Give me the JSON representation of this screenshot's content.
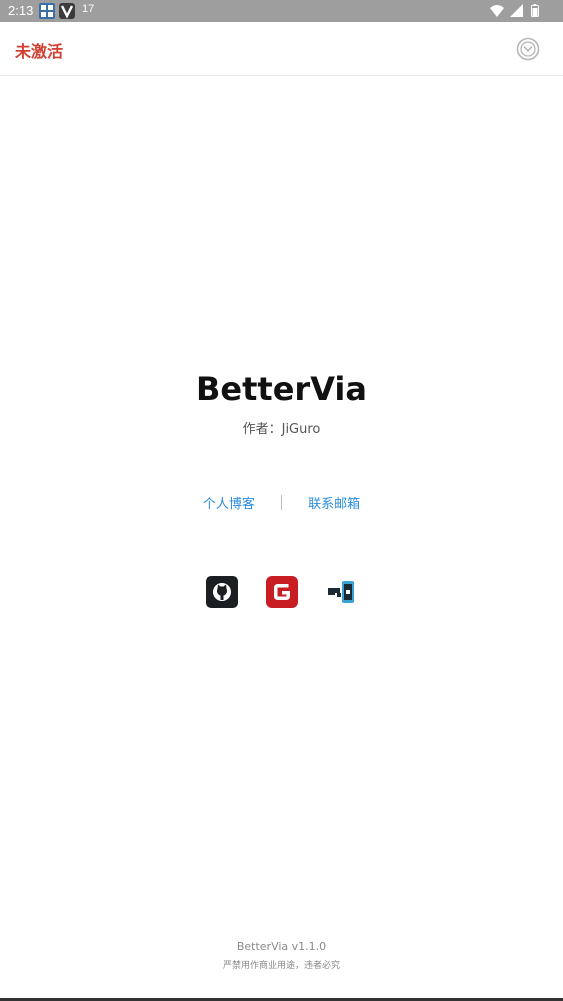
{
  "status_bar": {
    "time": "2:13",
    "signal_text": "17",
    "icons": [
      "grid-app-icon",
      "v-app-icon",
      "wifi-icon",
      "cell-signal-icon",
      "battery-icon"
    ]
  },
  "app_bar": {
    "activation_status": "未激活",
    "activation_color": "#d23f31",
    "menu_icon": "circle-chevron-down-icon"
  },
  "main": {
    "app_name": "BetterVia",
    "author_line": "作者：JiGuro",
    "links": {
      "blog": "个人博客",
      "email": "联系邮箱"
    },
    "link_color": "#2a8ddf",
    "social_icons": [
      "github-icon",
      "gitee-icon",
      "coolapk-icon"
    ]
  },
  "footer": {
    "version": "BetterVia v1.1.0",
    "notice": "严禁用作商业用途，违者必究"
  }
}
